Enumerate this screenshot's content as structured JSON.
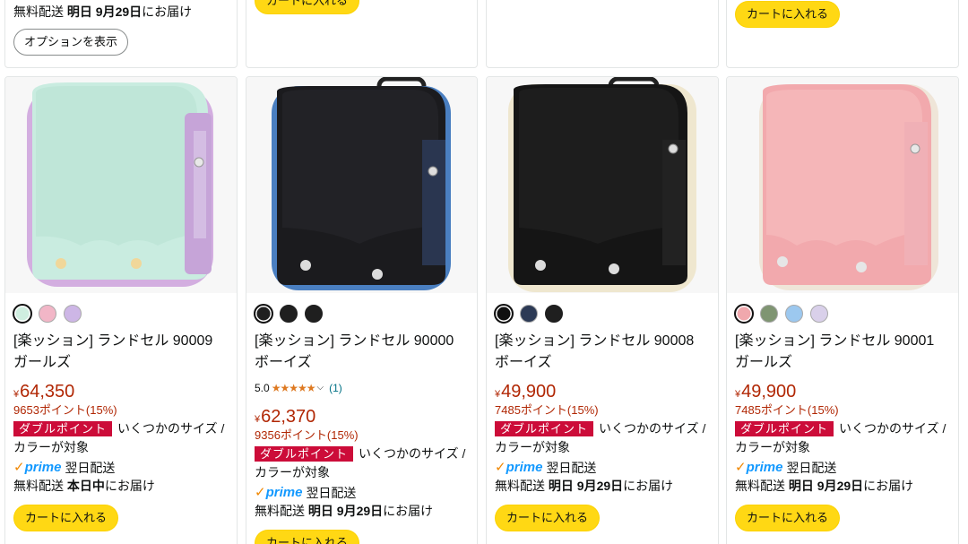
{
  "top_row": {
    "card1": {
      "shipping_prefix": "無料配送",
      "shipping_day": "明日 9月29日",
      "shipping_suffix": "にお届け",
      "options_label": "オプションを表示"
    },
    "card2": {
      "cart_label": "カートに入れる"
    },
    "card4": {
      "cart_label": "カートに入れる"
    }
  },
  "products": [
    {
      "image": "mint-randoseru-image",
      "swatches": [
        "#cfeee0",
        "#f2b6c7",
        "#cdb6e6"
      ],
      "title_line1": "[楽ッション] ランドセル 90009",
      "title_line2": "ガールズ",
      "currency": "¥",
      "price": "64,350",
      "points": "9653ポイント(15%)",
      "badge": "ダブルポイント",
      "promo_text": "いくつかのサイズ / カラーが対象",
      "prime_word": "prime",
      "prime_text": "翌日配送",
      "shipping_prefix": "無料配送",
      "shipping_day": "本日中",
      "shipping_suffix": "にお届け",
      "cart_label": "カートに入れる"
    },
    {
      "image": "black-blue-randoseru-image",
      "swatches": [
        "#1f1f1f",
        "#1f1f1f",
        "#1f1f1f"
      ],
      "title_line1": "[楽ッション] ランドセル 90000",
      "title_line2": "ボーイズ",
      "rating_value": "5.0",
      "rating_stars": 5,
      "rating_count": "(1)",
      "currency": "¥",
      "price": "62,370",
      "points": "9356ポイント(15%)",
      "badge": "ダブルポイント",
      "promo_text": "いくつかのサイズ / カラーが対象",
      "prime_word": "prime",
      "prime_text": "翌日配送",
      "shipping_prefix": "無料配送",
      "shipping_day": "明日 9月29日",
      "shipping_suffix": "にお届け",
      "cart_label": "カートに入れる"
    },
    {
      "image": "black-cream-randoseru-image",
      "swatches": [
        "#111111",
        "#2c3a55",
        "#1f1f1f"
      ],
      "title_line1": "[楽ッション] ランドセル 90008",
      "title_line2": "ボーイズ",
      "currency": "¥",
      "price": "49,900",
      "points": "7485ポイント(15%)",
      "badge": "ダブルポイント",
      "promo_text": "いくつかのサイズ / カラーが対象",
      "prime_word": "prime",
      "prime_text": "翌日配送",
      "shipping_prefix": "無料配送",
      "shipping_day": "明日 9月29日",
      "shipping_suffix": "にお届け",
      "cart_label": "カートに入れる"
    },
    {
      "image": "pink-randoseru-image",
      "swatches": [
        "#f0a8ad",
        "#7f9572",
        "#9cc8ef",
        "#d9d0ea"
      ],
      "title_line1": "[楽ッション] ランドセル 90001",
      "title_line2": "ガールズ",
      "currency": "¥",
      "price": "49,900",
      "points": "7485ポイント(15%)",
      "badge": "ダブルポイント",
      "promo_text": "いくつかのサイズ / カラーが対象",
      "prime_word": "prime",
      "prime_text": "翌日配送",
      "shipping_prefix": "無料配送",
      "shipping_day": "明日 9月29日",
      "shipping_suffix": "にお届け",
      "cart_label": "カートに入れる"
    }
  ],
  "colors": {
    "price": "#b12704",
    "badge": "#cc0c39",
    "cart_button": "#ffd814",
    "prime": "#1399ff",
    "star": "#de7921",
    "link": "#007185"
  }
}
